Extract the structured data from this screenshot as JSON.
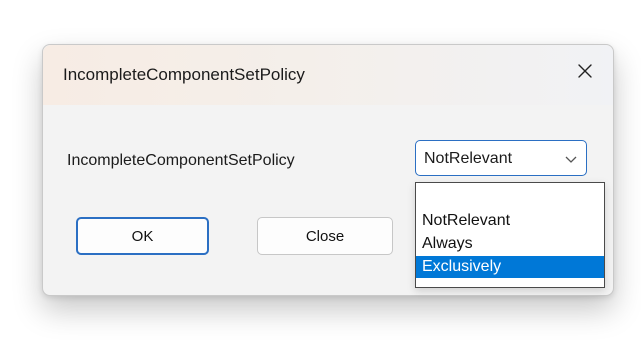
{
  "dialog": {
    "title": "IncompleteComponentSetPolicy",
    "close_icon": "close-icon"
  },
  "form": {
    "label": "IncompleteComponentSetPolicy",
    "selected_value": "NotRelevant",
    "options": [
      "",
      "NotRelevant",
      "Always",
      "Exclusively"
    ],
    "highlighted_option": "Exclusively"
  },
  "buttons": {
    "ok_label": "OK",
    "close_label": "Close"
  },
  "colors": {
    "accent": "#2b6fc3",
    "selection": "#0078d7",
    "dialog_bg": "#f3f3f3"
  }
}
